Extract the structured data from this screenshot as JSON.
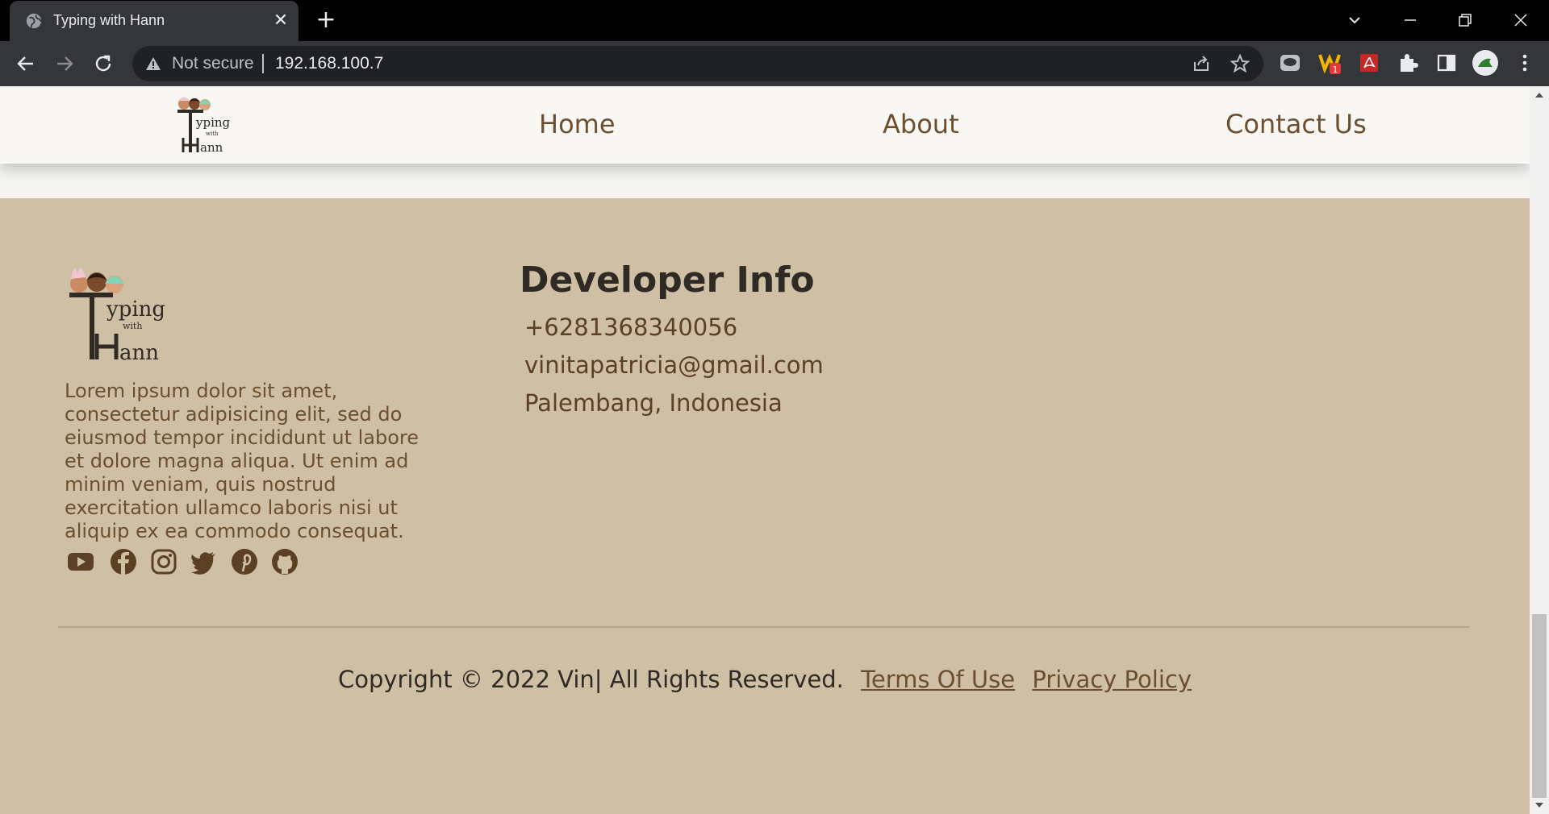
{
  "browser": {
    "tab_title": "Typing with Hann",
    "security_label": "Not secure",
    "url": "192.168.100.7",
    "extension_badge": "1"
  },
  "header": {
    "logo_text": [
      "yping",
      "with",
      "ann"
    ],
    "nav": [
      {
        "label": "Home"
      },
      {
        "label": "About"
      },
      {
        "label": "Contact Us"
      }
    ]
  },
  "footer": {
    "logo_text": [
      "yping",
      "with",
      "ann"
    ],
    "description": "Lorem ipsum dolor sit amet, consectetur adipisicing elit, sed do eiusmod tempor incididunt ut labore et dolore magna aliqua. Ut enim ad minim veniam, quis nostrud exercitation ullamco laboris nisi ut aliquip ex ea commodo consequat.",
    "socials": [
      "youtube-icon",
      "facebook-icon",
      "instagram-icon",
      "twitter-icon",
      "pinterest-icon",
      "github-icon"
    ],
    "developer_info": {
      "title": "Developer Info",
      "phone": "+6281368340056",
      "email": "vinitapatricia@gmail.com",
      "location": "Palembang, Indonesia"
    },
    "copyright": "Copyright © 2022 Vin| All Rights Reserved.",
    "links": {
      "terms": "Terms Of Use",
      "privacy": "Privacy Policy"
    }
  },
  "colors": {
    "chrome_bg": "#000000",
    "toolbar_bg": "#35363a",
    "header_bg": "#f8f7f3",
    "footer_bg": "#cfc0a5",
    "accent_brown": "#6b4f2e",
    "dark_text": "#2f2a24"
  }
}
